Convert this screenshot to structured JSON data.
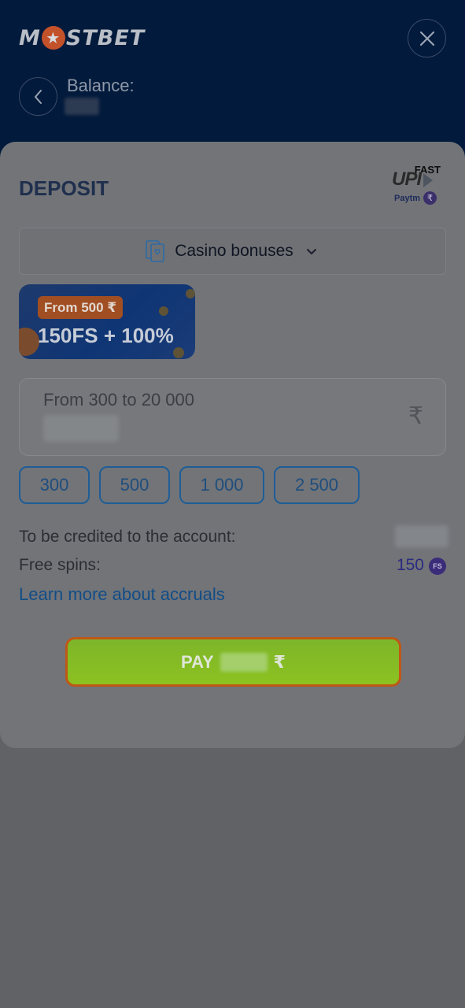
{
  "header": {
    "logo_left": "M",
    "logo_star": "★",
    "logo_right": "STBET",
    "balance_label": "Balance:"
  },
  "deposit": {
    "title": "DEPOSIT",
    "payment_badges": {
      "fast": "FAST",
      "upi": "UPI",
      "paytm": "Paytm",
      "rupee": "₹"
    },
    "bonus_select": {
      "label": "Casino bonuses"
    },
    "promo": {
      "badge": "From 500 ₹",
      "main": "150FS + 100%"
    },
    "amount": {
      "placeholder": "From 300 to 20 000",
      "currency": "₹"
    },
    "quick_amounts": [
      "300",
      "500",
      "1 000",
      "2 500"
    ],
    "credited_label": "To be credited to the account:",
    "free_spins_label": "Free spins:",
    "free_spins_value": "150",
    "fs_badge": "FS",
    "learn_more": "Learn more about accruals",
    "pay_label": "PAY",
    "pay_currency": "₹"
  },
  "colors": {
    "header_bg": "#021a3c",
    "accent_blue": "#1f5d96",
    "pay_green": "#8cc220",
    "pay_border": "#c05716"
  }
}
